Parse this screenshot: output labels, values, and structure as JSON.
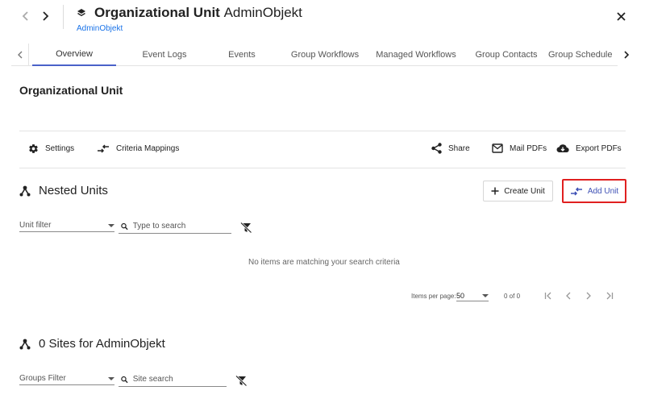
{
  "header": {
    "title_bold": "Organizational Unit",
    "title_normal": "AdminObjekt",
    "breadcrumb": "AdminObjekt",
    "back_icon": "chevron-left-icon",
    "forward_icon": "chevron-right-icon",
    "unit_icon": "layers-icon",
    "close_icon": "close-icon"
  },
  "tabs": [
    {
      "label": "Overview",
      "active": true
    },
    {
      "label": "Event Logs"
    },
    {
      "label": "Events"
    },
    {
      "label": "Group Workflows"
    },
    {
      "label": "Managed Workflows"
    },
    {
      "label": "Group Contacts"
    },
    {
      "label": "Group Schedule"
    }
  ],
  "page_title": "Organizational Unit",
  "toolbar": {
    "settings": "Settings",
    "criteria_mappings": "Criteria Mappings",
    "share": "Share",
    "mail_pdfs": "Mail PDFs",
    "export_pdfs": "Export PDFs"
  },
  "nested_units": {
    "title": "Nested Units",
    "create_unit": "Create Unit",
    "add_unit": "Add Unit",
    "unit_filter": "Unit filter",
    "search_placeholder": "Type to search",
    "empty_message": "No items are matching your search criteria"
  },
  "pagination": {
    "items_per_page_label": "Items per page:",
    "items_per_page_value": "50",
    "range": "0 of 0"
  },
  "sites": {
    "title": "0 Sites for AdminObjekt",
    "groups_filter": "Groups Filter",
    "search_placeholder": "Site search"
  },
  "colors": {
    "accent": "#3f51b5",
    "link": "#1a73e8",
    "highlight_border": "#e02020"
  }
}
